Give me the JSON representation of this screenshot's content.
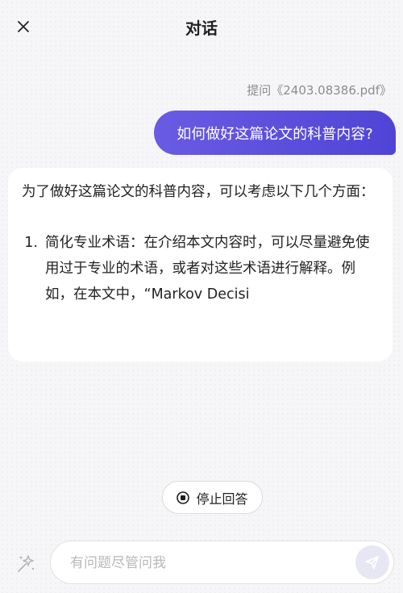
{
  "header": {
    "title": "对话",
    "close_icon": "close-icon"
  },
  "conversation": {
    "quote": "提问《2403.08386.pdf》",
    "user_message": "如何做好这篇论文的科普内容?",
    "assistant": {
      "intro": "为了做好这篇论文的科普内容，可以考虑以下几个方面：",
      "items": [
        {
          "number": "1.",
          "text": "简化专业术语：在介绍本文内容时，可以尽量避免使用过于专业的术语，或者对这些术语进行解释。例如，在本文中，“Markov Decisi"
        }
      ]
    }
  },
  "controls": {
    "stop_label": "停止回答",
    "stop_icon": "stop-circle-icon"
  },
  "composer": {
    "placeholder": "有问题尽管问我",
    "value": "",
    "magic_icon": "magic-sparkle-icon",
    "send_icon": "send-icon"
  },
  "colors": {
    "accent_start": "#6a5be3",
    "accent_end": "#4f44d6",
    "send_button_bg": "#e7e6f3"
  }
}
